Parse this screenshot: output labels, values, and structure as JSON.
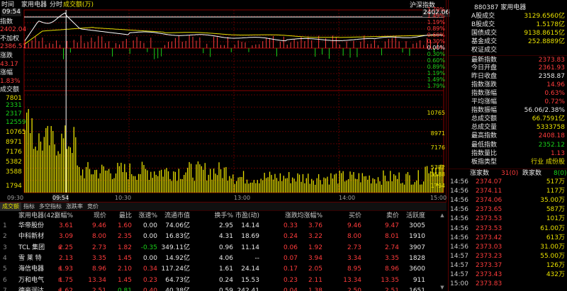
{
  "top_bar": {
    "time_label": "时间",
    "sector_name": "家用电器",
    "tab_intraday": "分时",
    "tab_volume": "成交额(万)",
    "compare_label": "沪深指数",
    "cursor_time": "09:54",
    "cursor_price": "2402.06"
  },
  "left_info": {
    "index_label": "指数",
    "index_value": "2402.04",
    "unadj_label": "不加权",
    "unadj_value": "2386.51",
    "change_label": "涨跌",
    "change_value": "43.17",
    "pct_label": "涨幅",
    "pct_value": "1.83%",
    "amount_label": "成交额",
    "amount_value": "7801"
  },
  "price_axis": {
    "right": [
      "1.79%",
      "1.49%",
      "1.19%",
      "0.89%",
      "0.60%",
      "0.30%",
      "0.00%",
      "0.30%",
      "0.60%",
      "0.89%",
      "1.19%",
      "1.49%",
      "1.79%"
    ]
  },
  "volume_axis": {
    "left": [
      "2331",
      "2317",
      "12559",
      "10765",
      "8971",
      "7176",
      "5382",
      "3588",
      "1794"
    ],
    "right": [
      "10765",
      "8971",
      "7176",
      "5382",
      "3588",
      "1794"
    ]
  },
  "time_axis": [
    "09:30",
    "09:54",
    "10:30",
    "13:00",
    "14:00",
    "15:00"
  ],
  "chart_data": {
    "type": "line",
    "title": "家用电器",
    "series": [
      {
        "name": "指数",
        "color": "#ffffff"
      },
      {
        "name": "不加权",
        "color": "#e8e000"
      }
    ],
    "ylim_pct": [
      -1.79,
      1.79
    ]
  },
  "right_panel": {
    "header": "880387 家用电器",
    "stats": [
      {
        "k": "A股成交",
        "v": "3129.6560亿",
        "c": "yellow"
      },
      {
        "k": "B股成交",
        "v": "1.5178亿",
        "c": "yellow"
      },
      {
        "k": "国债成交",
        "v": "9138.8615亿",
        "c": "yellow"
      },
      {
        "k": "基金成交",
        "v": "252.8889亿",
        "c": "yellow"
      },
      {
        "k": "权证成交",
        "v": "",
        "c": "yellow"
      },
      {
        "k": "最新指数",
        "v": "2373.83",
        "c": "red"
      },
      {
        "k": "今日开盘",
        "v": "2361.93",
        "c": "red"
      },
      {
        "k": "昨日收盘",
        "v": "2358.87",
        "c": "white"
      },
      {
        "k": "指数涨跌",
        "v": "14.96",
        "c": "red"
      },
      {
        "k": "指数涨幅",
        "v": "0.63%",
        "c": "red"
      },
      {
        "k": "平均涨幅",
        "v": "0.72%",
        "c": "red"
      },
      {
        "k": "指数振幅",
        "v": "56.06/2.38%",
        "c": "white"
      },
      {
        "k": "总成交额",
        "v": "66.7591亿",
        "c": "yellow"
      },
      {
        "k": "总成交量",
        "v": "5333758",
        "c": "yellow"
      },
      {
        "k": "最高指数",
        "v": "2408.18",
        "c": "red"
      },
      {
        "k": "最低指数",
        "v": "2352.12",
        "c": "green"
      },
      {
        "k": "指数量比",
        "v": "1.13",
        "c": "red"
      },
      {
        "k": "板指类型",
        "v": "行业 成份股",
        "c": "yellow"
      }
    ],
    "up_label": "涨家数",
    "up_count": "31(0)",
    "down_label": "跌家数",
    "down_count": "8(0)",
    "ticks": [
      {
        "t": "14:56",
        "p": "2374.07",
        "v": "517万"
      },
      {
        "t": "14:56",
        "p": "2374.11",
        "v": "117万"
      },
      {
        "t": "14:56",
        "p": "2374.06",
        "v": "35.00万"
      },
      {
        "t": "14:56",
        "p": "2373.65",
        "v": "587万"
      },
      {
        "t": "14:56",
        "p": "2373.53",
        "v": "101万"
      },
      {
        "t": "14:56",
        "p": "2373.53",
        "v": "61.00万"
      },
      {
        "t": "14:56",
        "p": "2373.42",
        "v": "613万"
      },
      {
        "t": "14:56",
        "p": "2373.03",
        "v": "31.00万"
      },
      {
        "t": "14:57",
        "p": "2373.23",
        "v": "55.00万"
      },
      {
        "t": "14:57",
        "p": "2373.37",
        "v": "126万"
      },
      {
        "t": "14:57",
        "p": "2373.43",
        "v": "432万"
      },
      {
        "t": "15:00",
        "p": "2373.83",
        "v": ""
      }
    ]
  },
  "table": {
    "tabs": [
      "成交额",
      "指标",
      "多空指标",
      "涨跌率",
      "竞价"
    ],
    "headers": [
      "家用电器(42)",
      "涨幅%",
      "现价",
      "最比",
      "涨速%",
      "流通市值",
      "换手%",
      "市盈(动)",
      "涨跌",
      "均涨幅%",
      "买价",
      "卖价",
      "活跃度"
    ],
    "rows": [
      {
        "flag": "",
        "name": "华帝股份",
        "c": [
          "3.61",
          "9.46",
          "1.60",
          "0.00",
          "74.06亿",
          "2.95",
          "14.14",
          "0.33",
          "3.76",
          "9.46",
          "9.47",
          "3005"
        ],
        "cc": [
          "red",
          "red",
          "red",
          "white",
          "white",
          "white",
          "white",
          "red",
          "red",
          "red",
          "red",
          "white"
        ]
      },
      {
        "flag": "",
        "name": "中科新材",
        "c": [
          "3.09",
          "8.00",
          "2.35",
          "0.00",
          "16.83亿",
          "4.31",
          "18.69",
          "0.24",
          "3.22",
          "8.00",
          "8.01",
          "1910"
        ],
        "cc": [
          "red",
          "red",
          "red",
          "white",
          "white",
          "white",
          "white",
          "red",
          "red",
          "red",
          "red",
          "white"
        ]
      },
      {
        "flag": "R",
        "name": "TCL 集团",
        "c": [
          "2.25",
          "2.73",
          "1.82",
          "-0.35",
          "349.11亿",
          "0.96",
          "11.14",
          "0.06",
          "1.92",
          "2.73",
          "2.74",
          "3907"
        ],
        "cc": [
          "red",
          "red",
          "red",
          "green",
          "white",
          "white",
          "white",
          "red",
          "red",
          "red",
          "red",
          "white"
        ]
      },
      {
        "flag": "",
        "name": "雪 莱 特",
        "c": [
          "2.13",
          "3.35",
          "1.45",
          "0.00",
          "14.92亿",
          "4.06",
          "--",
          "0.07",
          "3.94",
          "3.34",
          "3.35",
          "1828"
        ],
        "cc": [
          "red",
          "red",
          "red",
          "white",
          "white",
          "white",
          "white",
          "red",
          "red",
          "red",
          "red",
          "white"
        ]
      },
      {
        "flag": "R",
        "name": "海信电器",
        "c": [
          "1.93",
          "8.96",
          "2.10",
          "0.34",
          "117.24亿",
          "1.61",
          "24.14",
          "0.17",
          "2.05",
          "8.95",
          "8.96",
          "3600"
        ],
        "cc": [
          "red",
          "red",
          "red",
          "red",
          "white",
          "white",
          "white",
          "red",
          "red",
          "red",
          "red",
          "white"
        ]
      },
      {
        "flag": "R",
        "name": "万和电气",
        "c": [
          "1.75",
          "13.34",
          "1.45",
          "0.23",
          "64.73亿",
          "0.24",
          "15.53",
          "0.23",
          "2.11",
          "13.34",
          "13.35",
          "911"
        ],
        "cc": [
          "red",
          "red",
          "red",
          "red",
          "white",
          "white",
          "white",
          "red",
          "red",
          "red",
          "red",
          "white"
        ]
      },
      {
        "flag": "R",
        "name": "德豪润达",
        "c": [
          "1.62",
          "2.51",
          "0.81",
          "0.40",
          "40.38亿",
          "0.59",
          "242.41",
          "0.04",
          "1.38",
          "2.50",
          "2.51",
          "1651"
        ],
        "cc": [
          "red",
          "red",
          "green",
          "red",
          "white",
          "white",
          "white",
          "red",
          "red",
          "red",
          "red",
          "white"
        ]
      }
    ]
  }
}
